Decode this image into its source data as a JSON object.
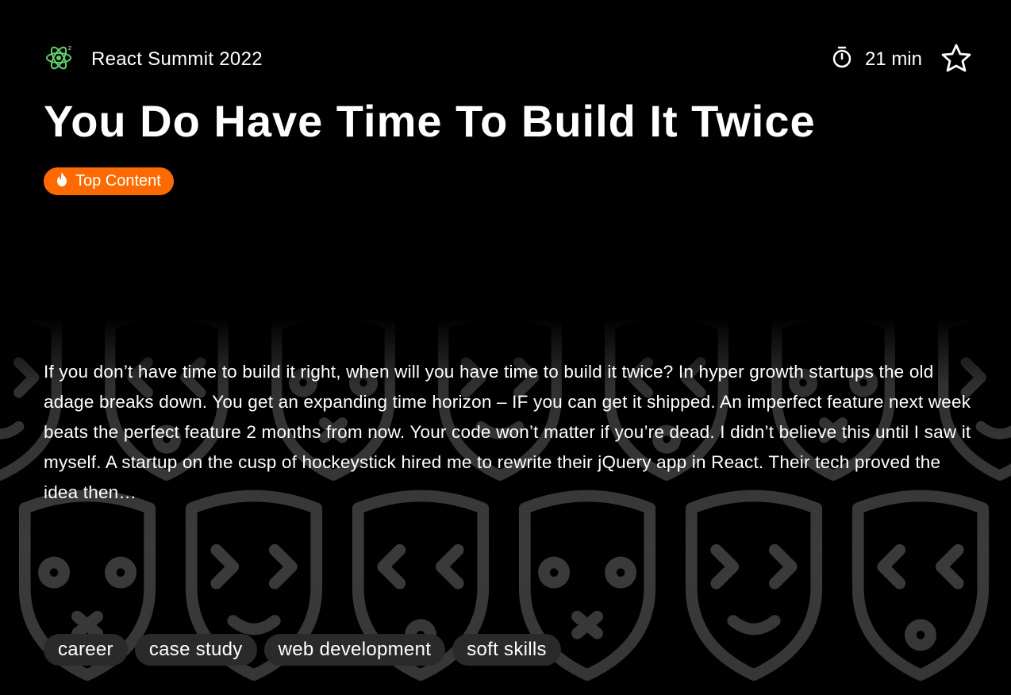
{
  "event": {
    "name": "React Summit 2022",
    "logo_icon": "react-atom-icon"
  },
  "duration": {
    "icon": "stopwatch-icon",
    "label": "21 min"
  },
  "favorite": {
    "icon": "star-outline-icon"
  },
  "talk": {
    "title": "You Do Have Time To Build It Twice",
    "badge": {
      "label": "Top Content",
      "icon": "flame-icon",
      "color": "#ff6a00"
    },
    "description": "If you don’t have time to build it right, when will you have time to build it twice? In hyper growth startups the old adage breaks down. You get an expanding time horizon – IF you can get it shipped. An imperfect feature next week beats the perfect feature 2 months from now. Your code won’t matter if you’re dead. I didn’t believe this until I saw it myself. A startup on the cusp of hockeystick hired me to rewrite their jQuery app in React. Their tech proved the idea then…"
  },
  "tags": [
    "career",
    "case study",
    "web development",
    "soft skills"
  ],
  "colors": {
    "background": "#000000",
    "accent": "#ff6a00",
    "logo": "#61d36b",
    "tag_bg": "#2a2a2a"
  }
}
